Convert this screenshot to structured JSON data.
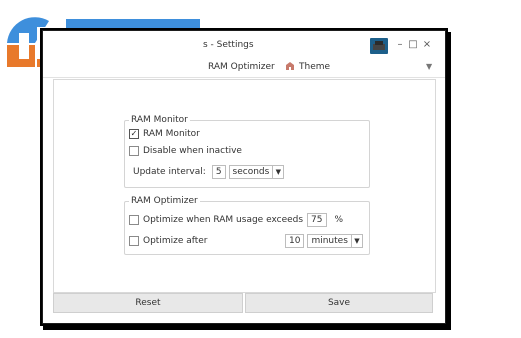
{
  "window": {
    "title": "s - Settings",
    "controls": {
      "minimize": "–",
      "maximize": "□",
      "close": "×"
    }
  },
  "tabs": {
    "ram": "RAM Optimizer",
    "theme": "Theme",
    "dropdown": "▼"
  },
  "ram_monitor": {
    "legend": "RAM Monitor",
    "monitor_label": "RAM Monitor",
    "monitor_checked": "✓",
    "disable_label": "Disable when inactive",
    "interval_label": "Update interval:",
    "interval_value": "5",
    "interval_unit": "seconds"
  },
  "ram_optimizer": {
    "legend": "RAM Optimizer",
    "usage_label": "Optimize when RAM usage exceeds",
    "usage_value": "75",
    "usage_unit": "%",
    "after_label": "Optimize after",
    "after_value": "10",
    "after_unit": "minutes"
  },
  "buttons": {
    "reset": "Reset",
    "save": "Save"
  },
  "colors": {
    "logo_blue": "#3e8fdc",
    "logo_orange": "#e8792b",
    "overlay_dark": "#3f3f3f"
  },
  "icons": [
    "logo-icon",
    "app-icon",
    "theme-icon",
    "chevron-down-icon"
  ]
}
